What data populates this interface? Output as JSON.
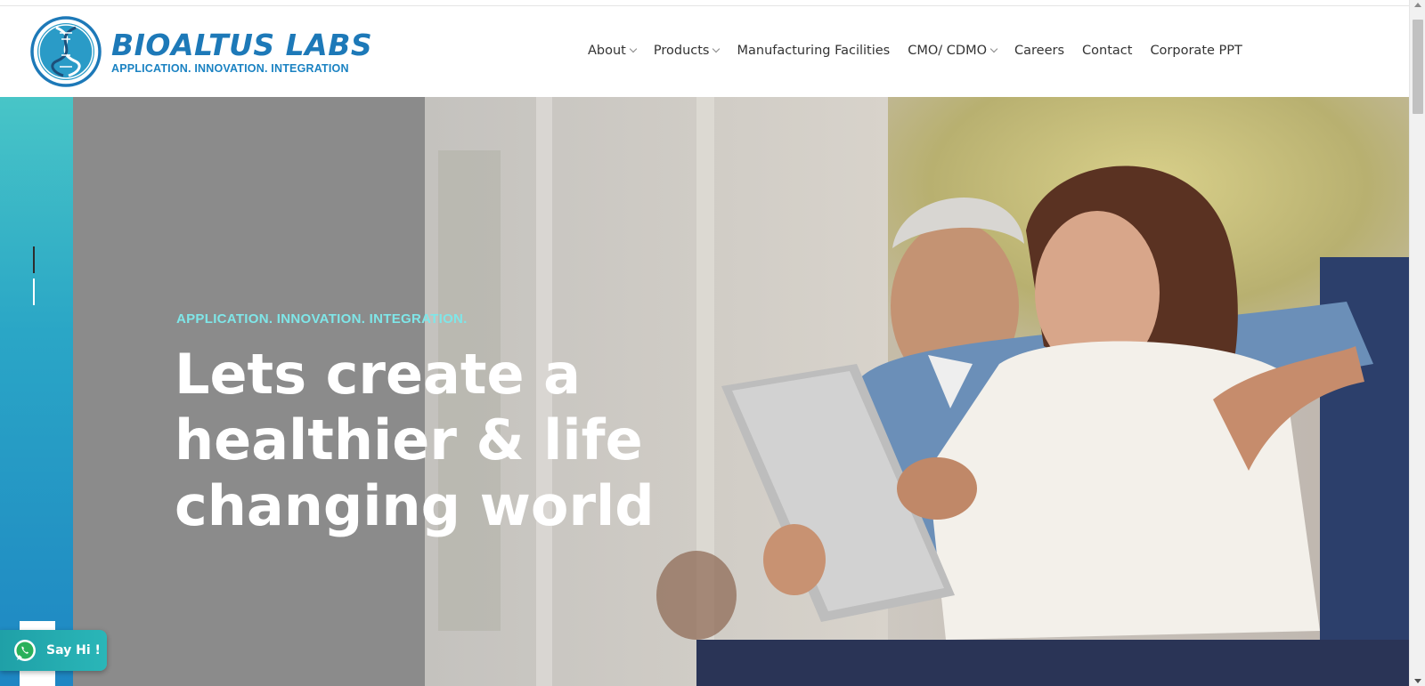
{
  "brand": {
    "name": "BIOALTUS LABS",
    "tagline": "APPLICATION. INNOVATION. INTEGRATION",
    "primary_color": "#1d79b8",
    "accent_color": "#48c5c7"
  },
  "nav": {
    "items": [
      {
        "label": "About",
        "has_dropdown": true
      },
      {
        "label": "Products",
        "has_dropdown": true
      },
      {
        "label": "Manufacturing Facilities",
        "has_dropdown": false
      },
      {
        "label": "CMO/ CDMO",
        "has_dropdown": true
      },
      {
        "label": "Careers",
        "has_dropdown": false
      },
      {
        "label": "Contact",
        "has_dropdown": false
      },
      {
        "label": "Corporate PPT",
        "has_dropdown": false
      }
    ]
  },
  "hero": {
    "tagline": "APPLICATION. INNOVATION. INTEGRATION.",
    "headline_lines": [
      "Lets create a",
      "healthier & life",
      "changing world"
    ],
    "tagline_color": "#7fe6e8"
  },
  "chat_widget": {
    "label": "Say Hi !",
    "icon": "whatsapp-icon"
  }
}
